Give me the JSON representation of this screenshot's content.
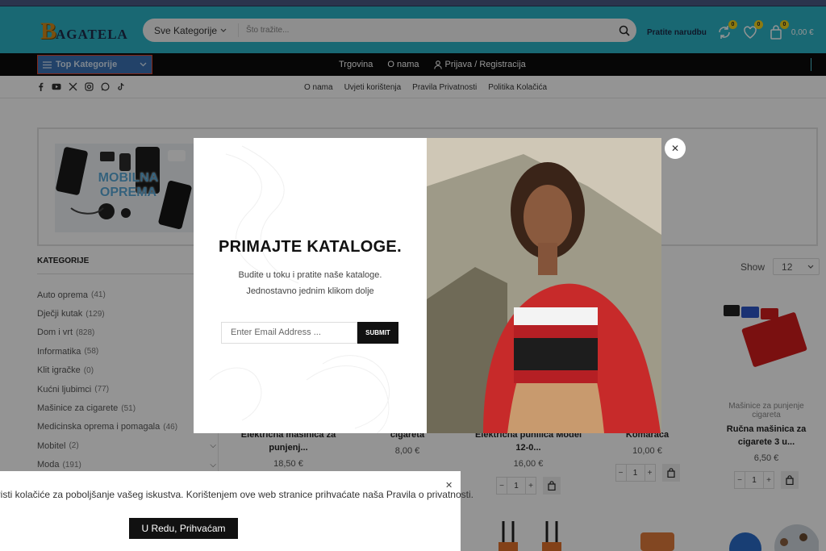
{
  "header": {
    "logo_big": "B",
    "logo_rest": "AGATELA",
    "search_category": "Sve Kategorije",
    "search_placeholder": "Što tražite...",
    "track_order": "Pratite narudbu",
    "compare_count": "0",
    "wishlist_count": "0",
    "cart_count": "0",
    "cart_total": "0,00 €"
  },
  "navbar": {
    "top_categories": "Top Kategorije",
    "links": [
      "Trgovina",
      "O nama"
    ],
    "login": "Prijava / Registracija"
  },
  "subbar": {
    "socials": [
      "facebook-icon",
      "youtube-icon",
      "x-icon",
      "instagram-icon",
      "whatsapp-icon",
      "tiktok-icon"
    ],
    "links": [
      "O nama",
      "Uvjeti korištenja",
      "Pravila Privatnosti",
      "Politika Kolačića"
    ]
  },
  "banner": {
    "line1": "MOBILNA",
    "line2": "OPREMA"
  },
  "sidebar": {
    "title": "KATEGORIJE",
    "categories": [
      {
        "name": "Auto oprema",
        "count": "(41)"
      },
      {
        "name": "Dječji kutak",
        "count": "(129)"
      },
      {
        "name": "Dom i vrt",
        "count": "(828)"
      },
      {
        "name": "Informatika",
        "count": "(58)"
      },
      {
        "name": "Klit igračke",
        "count": "(0)"
      },
      {
        "name": "Kućni ljubimci",
        "count": "(77)"
      },
      {
        "name": "Mašinice za cigarete",
        "count": "(51)"
      },
      {
        "name": "Medicinska oprema i pomagala",
        "count": "(46)"
      },
      {
        "name": "Mobitel",
        "count": "(2)"
      },
      {
        "name": "Moda",
        "count": "(191)"
      }
    ]
  },
  "toolbar": {
    "show_label": "Show",
    "show_value": "12"
  },
  "products": [
    {
      "category": "",
      "name1": "Električna mašinica za",
      "name2": "punjenj...",
      "price": "18,50 €",
      "qty": "1"
    },
    {
      "category": "",
      "name1": "cigareta",
      "name2": "",
      "price": "8,00 €",
      "qty": "1"
    },
    {
      "category": "",
      "name1": "Električna punilica Model",
      "name2": "12-0...",
      "price": "16,00 €",
      "qty": "1"
    },
    {
      "category": "ekata",
      "name1": "protiv",
      "name2": "Komaraca",
      "price": "10,00 €",
      "qty": "1"
    },
    {
      "category": "Mašinice za punjenje cigareta",
      "name1": "Ručna mašinica za",
      "name2": "cigarete 3 u...",
      "price": "6,50 €",
      "qty": "1"
    }
  ],
  "popup": {
    "title": "PRIMAJTE KATALOGE.",
    "desc1": "Budite u toku i pratite naše kataloge.",
    "desc2": "Jednostavno jednim klikom dolje",
    "email_placeholder": "Enter Email Address ...",
    "submit": "SUBMIT"
  },
  "cookie": {
    "text": "oristi kolačiće za poboljšanje vašeg iskustva. Korištenjem ove web stranice prihvaćate naša",
    "link": "Pravila o privatnosti.",
    "button": "U Redu, Prihvaćam"
  },
  "colors": {
    "header_bg": "#2bb4c6",
    "nav_bg": "#0b0b0b",
    "top_cat_bg": "#3b73b5",
    "badge": "#f2d21c"
  }
}
